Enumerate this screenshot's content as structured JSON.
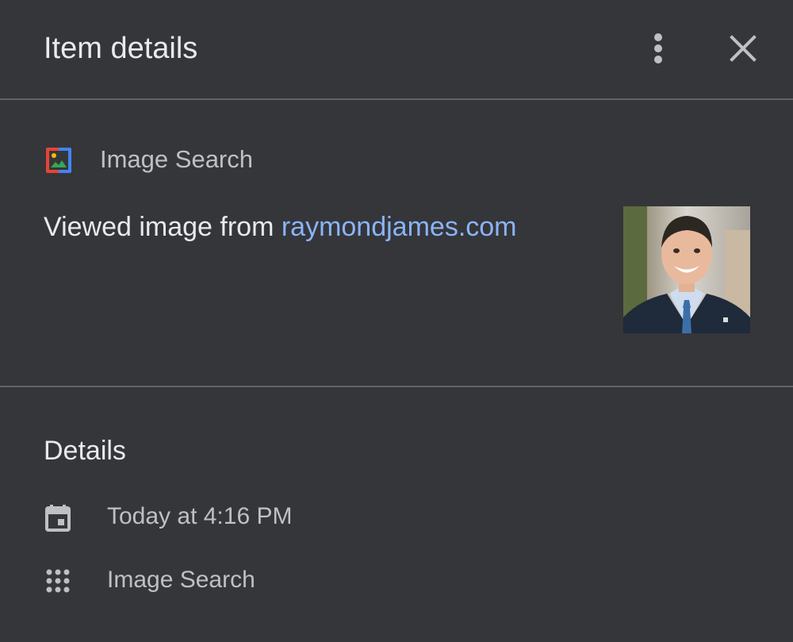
{
  "header": {
    "title": "Item details",
    "more_icon": "more-vert-icon",
    "close_icon": "close-icon"
  },
  "activity": {
    "source_icon": "image-search-icon",
    "source_name": "Image Search",
    "text_prefix": "Viewed image from ",
    "link_text": "raymondjames.com",
    "thumbnail_icon": "thumbnail-image"
  },
  "details": {
    "heading": "Details",
    "rows": [
      {
        "icon": "calendar-icon",
        "text": "Today at 4:16 PM"
      },
      {
        "icon": "apps-grid-icon",
        "text": "Image Search"
      }
    ]
  },
  "colors": {
    "background": "#35363a",
    "divider": "#5f6368",
    "primary_text": "#e8eaed",
    "secondary_text": "#bdc1c6",
    "link": "#8ab4f8"
  }
}
